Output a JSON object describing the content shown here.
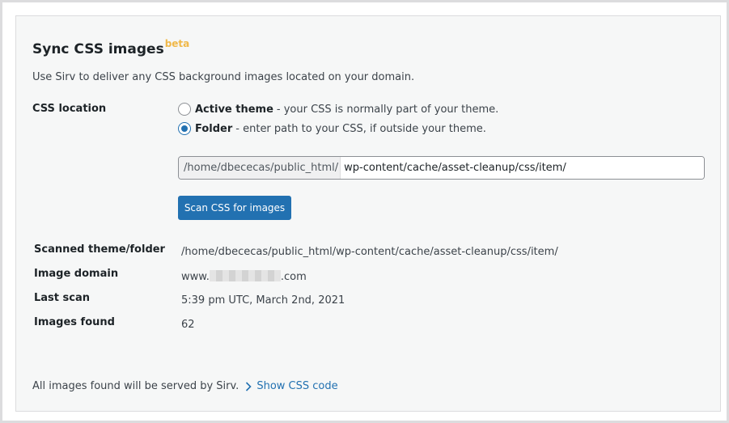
{
  "section": {
    "title": "Sync CSS images",
    "badge": "beta",
    "description": "Use Sirv to deliver any CSS background images located on your domain."
  },
  "css_location": {
    "label": "CSS location",
    "options": [
      {
        "bold": "Active theme",
        "text": "- your CSS is normally part of your theme.",
        "selected": false
      },
      {
        "bold": "Folder",
        "text": "- enter path to your CSS, if outside your theme.",
        "selected": true
      }
    ],
    "path_prefix": "/home/dbececas/public_html/",
    "path_value": "wp-content/cache/asset-cleanup/css/item/"
  },
  "scan_button": {
    "label": "Scan CSS for images"
  },
  "info": {
    "scanned_label": "Scanned theme/folder",
    "scanned_value": "/home/dbececas/public_html/wp-content/cache/asset-cleanup/css/item/",
    "domain_label": "Image domain",
    "domain_prefix": "www.",
    "domain_suffix": ".com",
    "last_scan_label": "Last scan",
    "last_scan_value": "5:39 pm UTC, March 2nd, 2021",
    "images_found_label": "Images found",
    "images_found_value": "62"
  },
  "footer": {
    "text": "All images found will be served by Sirv.",
    "link_label": "Show CSS code"
  },
  "colors": {
    "accent": "#2271b1",
    "beta": "#f0b849",
    "card_bg": "#f6f7f7"
  },
  "icons": {
    "show_link": "chevron-right-icon"
  }
}
